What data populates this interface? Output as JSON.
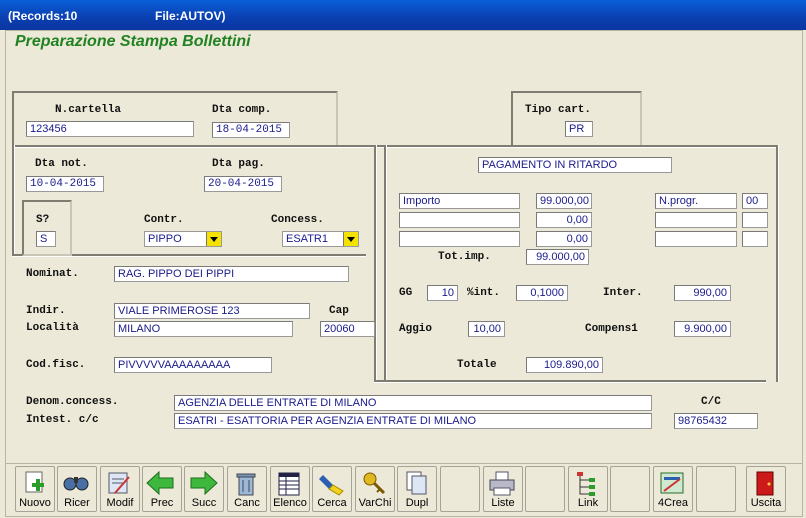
{
  "window": {
    "records": "(Records:10",
    "file": "File:AUTOV)"
  },
  "heading": "Preparazione Stampa Bollettini",
  "labels": {
    "n_cartella": "N.cartella",
    "dta_comp": "Dta comp.",
    "tipo_cart": "Tipo cart.",
    "dta_not": "Dta not.",
    "dta_pag": "Dta pag.",
    "s": "S?",
    "contr": "Contr.",
    "concess": "Concess.",
    "nominat": "Nominat.",
    "indir": "Indir.",
    "cap": "Cap",
    "localita": "Località",
    "cod_fisc": "Cod.fisc.",
    "denom": "Denom.concess.",
    "intest": "Intest. c/c",
    "cc": "C/C",
    "tot_imp": "Tot.imp.",
    "gg": "GG",
    "pint": "%int.",
    "inter": "Inter.",
    "aggio": "Aggio",
    "compens": "Compens1",
    "totale": "Totale"
  },
  "fields": {
    "n_cartella": "123456",
    "dta_comp": "18-04-2015",
    "tipo_cart": "PR",
    "dta_not": "10-04-2015",
    "dta_pag": "20-04-2015",
    "s": "S",
    "contr": "PIPPO",
    "concess": "ESATR1",
    "nominat": "RAG. PIPPO DEI PIPPI",
    "indir": "VIALE PRIMEROSE 123",
    "cap": "20060",
    "localita": "MILANO",
    "cod_fisc": "PIVVVVVAAAAAAAAA",
    "denom": "AGENZIA DELLE ENTRATE DI MILANO",
    "intest": "ESATRI - ESATTORIA PER AGENZIA ENTRATE DI MILANO",
    "cc": "98765432",
    "desc": "PAGAMENTO IN RITARDO",
    "imp_rows": [
      {
        "label": "Importo",
        "value": "99.000,00",
        "prog_label": "N.progr.",
        "prog": "00"
      },
      {
        "label": "",
        "value": "0,00",
        "prog_label": "",
        "prog": ""
      },
      {
        "label": "",
        "value": "0,00",
        "prog_label": "",
        "prog": ""
      }
    ],
    "tot_imp": "99.000,00",
    "gg": "10",
    "pint": "0,1000",
    "inter": "990,00",
    "aggio": "10,00",
    "compens": "9.900,00",
    "totale": "109.890,00"
  },
  "toolbar": {
    "nuovo": "Nuovo",
    "ricer": "Ricer",
    "modif": "Modif",
    "prec": "Prec",
    "succ": "Succ",
    "canc": "Canc",
    "elenco": "Elenco",
    "cerca": "Cerca",
    "varchi": "VarChi",
    "dupl": "Dupl",
    "liste": "Liste",
    "link": "Link",
    "crea": "4Crea",
    "uscita": "Uscita"
  }
}
